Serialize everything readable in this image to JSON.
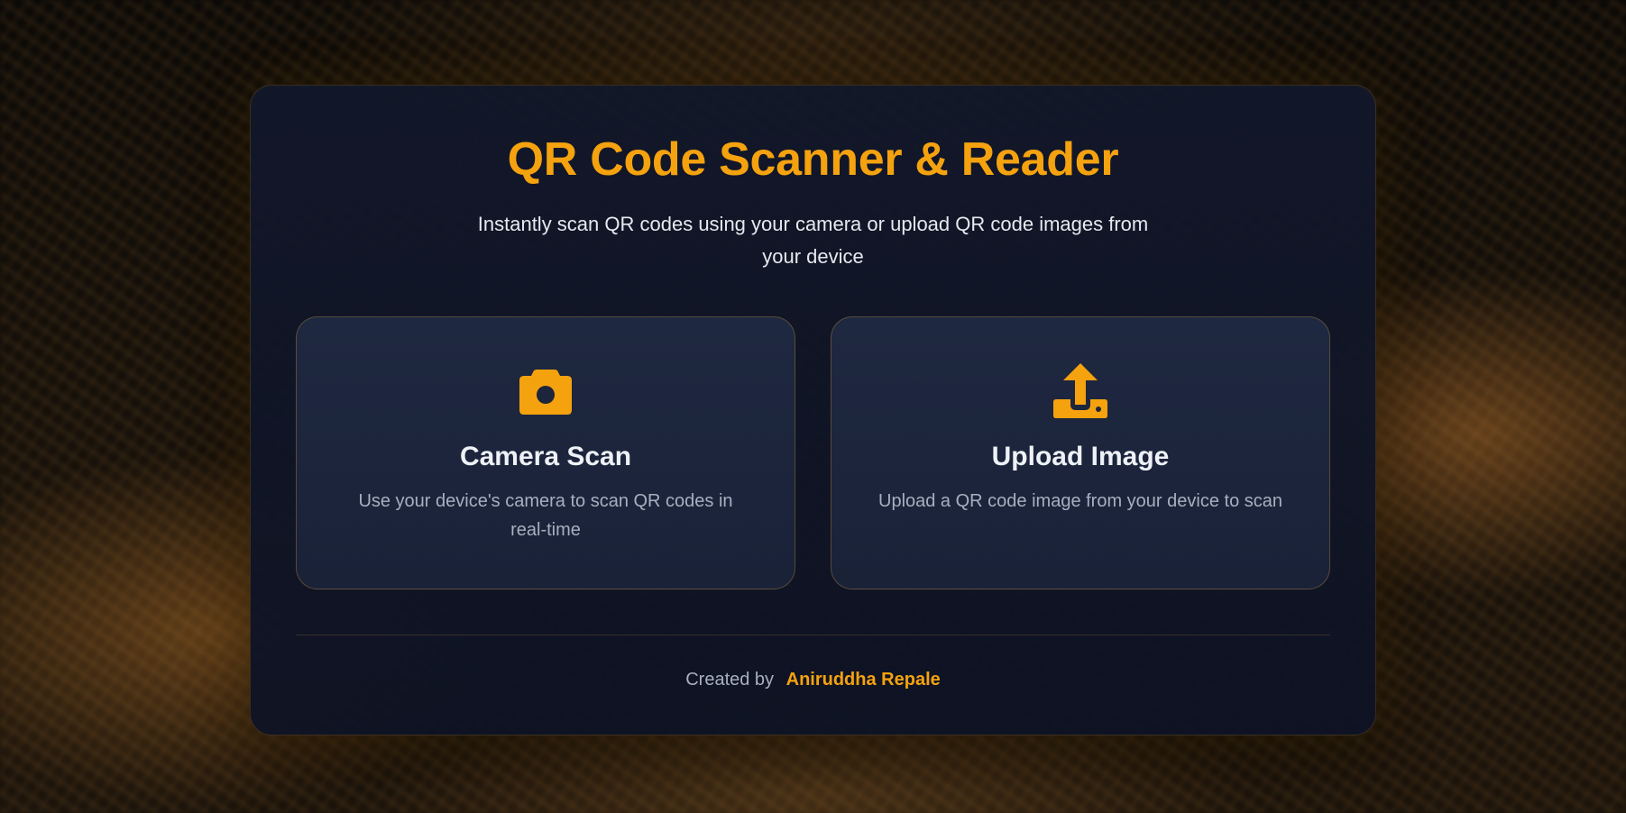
{
  "colors": {
    "accent": "#f5a20f",
    "card_bg": "#12182a",
    "option_bg": "#1e2840",
    "text_primary": "#eef1f6",
    "text_muted": "#a7b0c0"
  },
  "header": {
    "title": "QR Code Scanner & Reader",
    "subtitle": "Instantly scan QR codes using your camera or upload QR code images from your device"
  },
  "options": [
    {
      "icon": "camera-icon",
      "title": "Camera Scan",
      "description": "Use your device's camera to scan QR codes in real-time"
    },
    {
      "icon": "upload-icon",
      "title": "Upload Image",
      "description": "Upload a QR code image from your device to scan"
    }
  ],
  "footer": {
    "created_by_label": "Created by",
    "author": "Aniruddha Repale"
  }
}
